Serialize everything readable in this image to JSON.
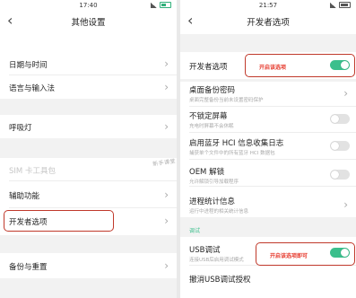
{
  "left": {
    "status_time": "17:40",
    "title": "其他设置",
    "back": "‹",
    "items": [
      {
        "label": "日期与时间"
      },
      {
        "label": "语言与输入法"
      },
      {
        "label": "呼吸灯"
      },
      {
        "label": "SIM 卡工具包"
      },
      {
        "label": "辅助功能"
      },
      {
        "label": "开发者选项"
      },
      {
        "label": "备份与重置"
      }
    ],
    "chevron": "›"
  },
  "right": {
    "status_time": "21:57",
    "title": "开发者选项",
    "back": "‹",
    "developer_option": {
      "label": "开发者选项",
      "annotation": "开启该选项",
      "enabled": true
    },
    "items": [
      {
        "label": "桌面备份密码",
        "sub": "桌面完整备份当前未设置密码保护"
      },
      {
        "label": "不锁定屏幕",
        "sub": "充电时屏幕不会休眠",
        "enabled": false
      },
      {
        "label": "启用蓝牙 HCI 信息收集日志",
        "sub": "捕获单个文件中的所有蓝牙 HCI 数据包",
        "enabled": false
      },
      {
        "label": "OEM 解锁",
        "sub": "允许解锁引导加载程序",
        "enabled": false
      },
      {
        "label": "进程统计信息",
        "sub": "运行中进程的相关统计信息"
      }
    ],
    "debug_section": "调试",
    "usb_debug": {
      "label": "USB调试",
      "sub": "连接USB后启用调试模式",
      "annotation": "开启该选项即可",
      "enabled": true
    },
    "revoke": {
      "label": "撤消USB调试授权"
    },
    "chevron": "›"
  },
  "watermark": "新手课堂"
}
